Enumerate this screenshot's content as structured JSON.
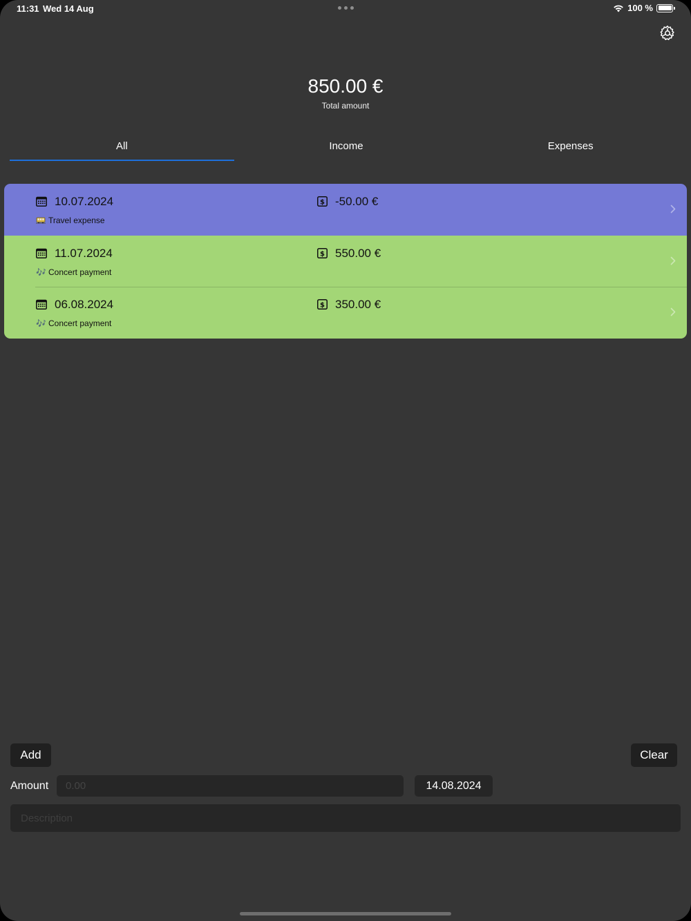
{
  "status_bar": {
    "time": "11:31",
    "date": "Wed 14 Aug",
    "battery": "100 %"
  },
  "summary": {
    "total": "850.00 €",
    "total_label": "Total amount"
  },
  "tabs": [
    {
      "label": "All",
      "active": true
    },
    {
      "label": "Income",
      "active": false
    },
    {
      "label": "Expenses",
      "active": false
    }
  ],
  "transactions": [
    {
      "date": "10.07.2024",
      "amount": "-50.00 €",
      "category_icon": "train-icon",
      "description": "Travel expense",
      "type": "expense"
    },
    {
      "date": "11.07.2024",
      "amount": "550.00 €",
      "category_icon": "music-notes-icon",
      "description": "Concert payment",
      "type": "income"
    },
    {
      "date": "06.08.2024",
      "amount": "350.00 €",
      "category_icon": "music-notes-icon",
      "description": "Concert payment",
      "type": "income"
    }
  ],
  "form": {
    "add_label": "Add",
    "clear_label": "Clear",
    "amount_label": "Amount",
    "amount_placeholder": "0.00",
    "amount_value": "",
    "date_value": "14.08.2024",
    "description_placeholder": "Description",
    "description_value": ""
  },
  "colors": {
    "background": "#363636",
    "expense_row": "#7479d6",
    "income_row": "#a3d676",
    "tab_indicator": "#1e6fd9",
    "field_background": "#262626"
  }
}
